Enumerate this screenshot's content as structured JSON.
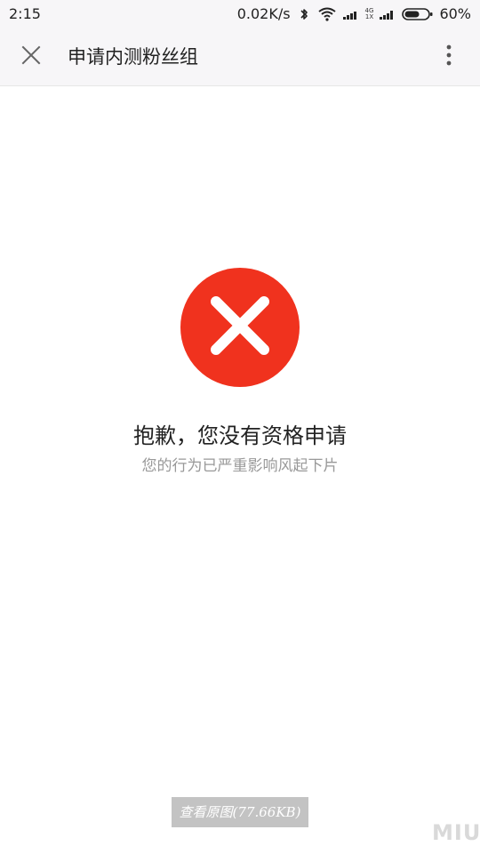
{
  "status_bar": {
    "time": "2:15",
    "network_speed": "0.02K/s",
    "network_type_top": "4G",
    "network_type_bottom": "1X",
    "battery_percent": "60%",
    "icons": [
      "bluetooth-icon",
      "wifi-icon",
      "signal-icon",
      "signal-icon",
      "battery-icon"
    ]
  },
  "app_bar": {
    "title": "申请内测粉丝组",
    "close_icon": "close-icon",
    "more_icon": "more-vertical-icon"
  },
  "error": {
    "title": "抱歉，您没有资格申请",
    "subtitle": "您的行为已严重影响风起下片",
    "icon": "error-x-icon",
    "color": "#f0321e"
  },
  "footer": {
    "view_original_label": "查看原图(77.66KB)",
    "watermark": "MIUI"
  }
}
